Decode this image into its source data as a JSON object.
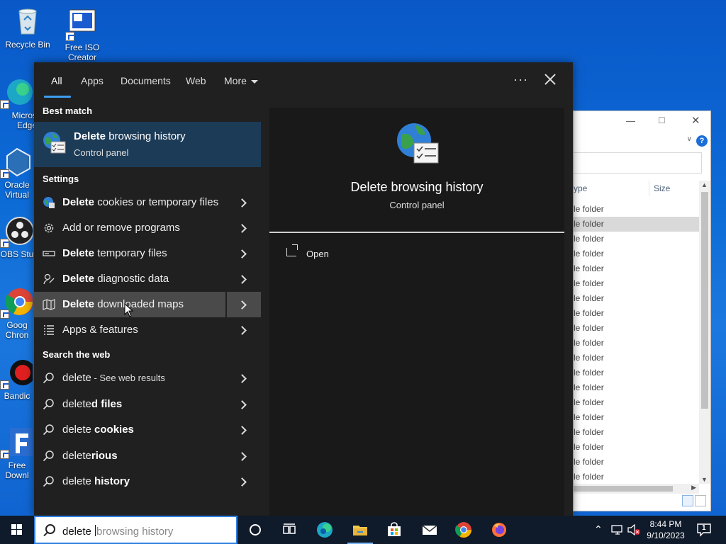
{
  "desktop": {
    "icons": [
      {
        "label": "Recycle Bin"
      },
      {
        "label": "Free ISO Creator"
      },
      {
        "label": "Micros Edge"
      },
      {
        "label": "Oracle Virtual"
      },
      {
        "label": "OBS Stu"
      },
      {
        "label": "Goog Chron"
      },
      {
        "label": "Bandic"
      },
      {
        "label": "Free Downl"
      }
    ]
  },
  "explorer": {
    "header_type": "ype",
    "header_size": "Size",
    "row_label": "le folder",
    "row_count": 19,
    "selected_row": 1
  },
  "search": {
    "tabs": [
      {
        "label": "All",
        "active": true
      },
      {
        "label": "Apps"
      },
      {
        "label": "Documents"
      },
      {
        "label": "Web"
      },
      {
        "label": "More"
      }
    ],
    "more_icon": "ellipsis-icon",
    "best_match_heading": "Best match",
    "best_match": {
      "title_bold": "Delete",
      "title_rest": " browsing history",
      "subtitle": "Control panel"
    },
    "settings_heading": "Settings",
    "settings_items": [
      {
        "bold": "Delete",
        "rest": " cookies or temporary files",
        "icon": "globe-settings-icon"
      },
      {
        "bold": "",
        "rest": "Add or remove programs",
        "icon": "gear-icon"
      },
      {
        "bold": "Delete",
        "rest": " temporary files",
        "icon": "storage-icon"
      },
      {
        "bold": "Delete",
        "rest": " diagnostic data",
        "icon": "feedback-icon"
      },
      {
        "bold": "Delete",
        "rest": " downloaded maps",
        "icon": "map-icon"
      },
      {
        "bold": "",
        "rest": "Apps & features",
        "icon": "list-icon"
      }
    ],
    "web_heading": "Search the web",
    "web_items": [
      {
        "normal": "delete",
        "bold": "",
        "small": " - See web results"
      },
      {
        "normal": "delete",
        "bold": "d files",
        "small": ""
      },
      {
        "normal": "delete",
        "bold": " cookies",
        "small": ""
      },
      {
        "normal": "delete",
        "bold": "rious",
        "small": ""
      },
      {
        "normal": "delete",
        "bold": " history",
        "small": ""
      }
    ],
    "preview": {
      "title": "Delete browsing history",
      "subtitle": "Control panel",
      "open_label": "Open"
    }
  },
  "taskbar": {
    "search_typed": "delete ",
    "search_suggestion": "browsing history",
    "time": "8:44 PM",
    "date": "9/10/2023",
    "notification_count": "1",
    "accent": "#2f7fe0"
  }
}
